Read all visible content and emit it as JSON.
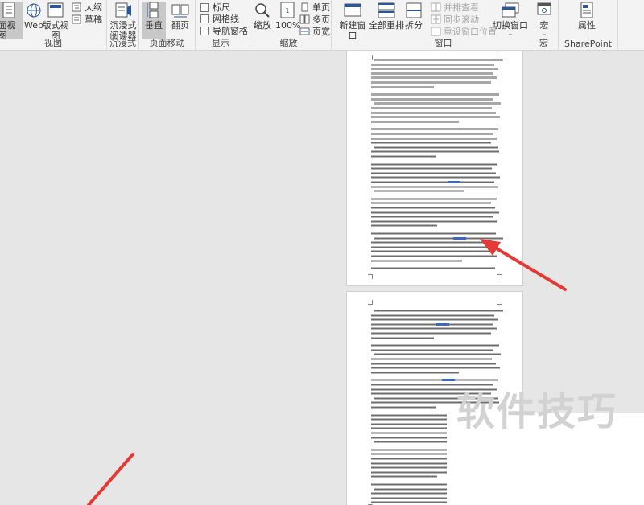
{
  "ribbon": {
    "views": {
      "print_layout": "页面视图",
      "web": "Web",
      "web_layout": "版式视图",
      "outline": "大纲",
      "draft": "草稿",
      "group_label": "视图"
    },
    "immersive": {
      "reader": "沉浸式阅读器",
      "group_label": "沉浸式"
    },
    "page_move": {
      "vertical": "垂直",
      "side_to_side": "翻页",
      "group_label": "页面移动"
    },
    "show": {
      "ruler": "标尺",
      "gridlines": "网格线",
      "nav_pane": "导航窗格",
      "group_label": "显示"
    },
    "zoom": {
      "zoom": "缩放",
      "hundred": "100%",
      "one_page": "单页",
      "multi_page": "多页",
      "page_width": "页宽",
      "group_label": "缩放"
    },
    "window": {
      "new_window": "新建窗口",
      "arrange_all": "全部重排",
      "split": "拆分",
      "side_by_side": "并排查看",
      "sync_scroll": "同步滚动",
      "reset_position": "重设窗口位置",
      "switch_windows": "切换窗口",
      "group_label": "窗口"
    },
    "macros": {
      "macros": "宏",
      "group_label": "宏"
    },
    "sharepoint": {
      "properties": "属性",
      "group_label": "SharePoint"
    }
  },
  "watermark": "软件技巧",
  "colors": {
    "accent": "#2b579a",
    "arrow": "#e53935",
    "link": "#3d67c4"
  }
}
